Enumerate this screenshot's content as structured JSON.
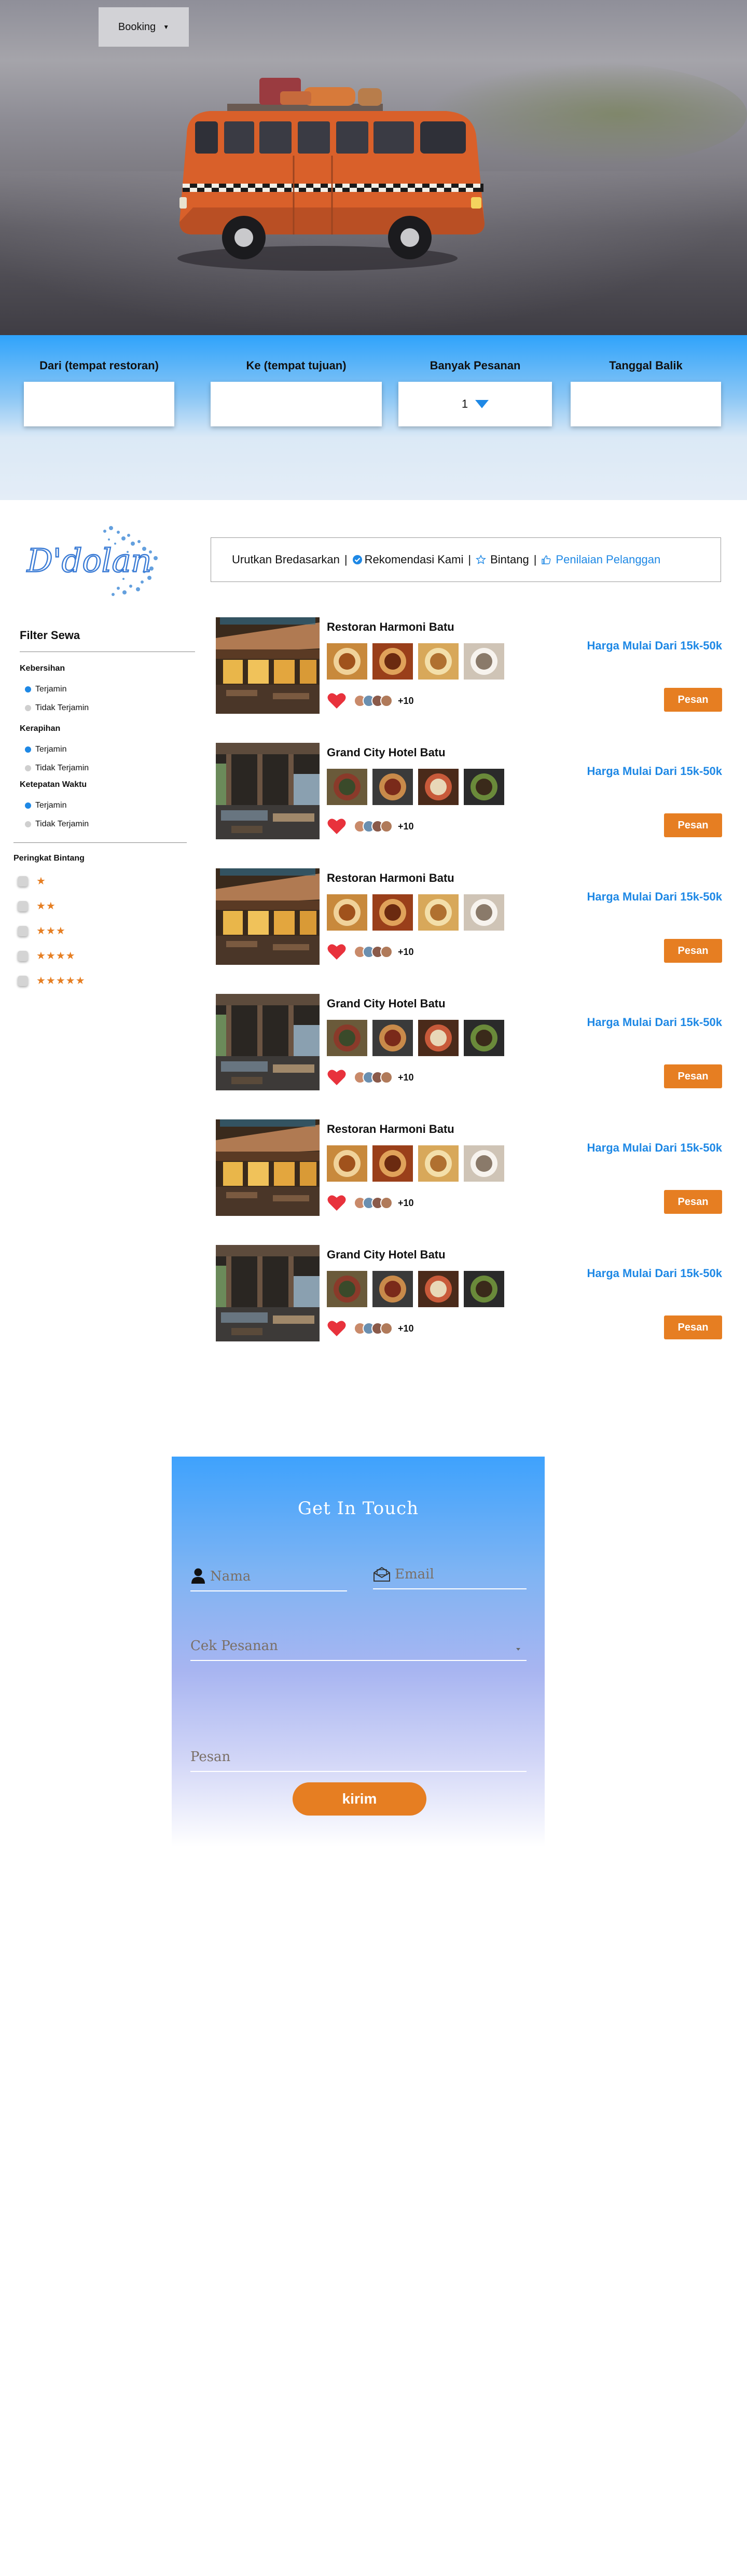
{
  "nav": {
    "booking_label": "Booking"
  },
  "search": {
    "from_label": "Dari (tempat restoran)",
    "to_label": "Ke (tempat tujuan)",
    "qty_label": "Banyak Pesanan",
    "qty_value": "1",
    "return_label": "Tanggal Balik"
  },
  "brand": {
    "logo_text": "D'dolan",
    "accent_color": "#1e88e5",
    "action_color": "#e67e22"
  },
  "sort": {
    "prefix": "Urutkan Bredasarkan",
    "options": [
      "Rekomendasi Kami",
      "Bintang",
      "Penilaian Pelanggan"
    ]
  },
  "filter": {
    "title": "Filter Sewa",
    "groups": [
      {
        "label": "Kebersihan",
        "options": [
          "Terjamin",
          "Tidak Terjamin"
        ]
      },
      {
        "label": "Kerapihan",
        "options": [
          "Terjamin",
          "Tidak Terjamin"
        ]
      },
      {
        "label": "Ketepatan Waktu",
        "options": [
          "Terjamin",
          "Tidak Terjamin"
        ]
      }
    ],
    "stars_title": "Peringkat Bintang",
    "star_rows": [
      "★",
      "★★",
      "★★★",
      "★★★★",
      "★★★★★"
    ]
  },
  "listings": [
    {
      "title": "Restoran Harmoni  Batu",
      "price": "Harga Mulai Dari 15k-50k",
      "more": "+10",
      "cta": "Pesan"
    },
    {
      "title": "Grand City Hotel Batu",
      "price": "Harga Mulai Dari 15k-50k",
      "more": "+10",
      "cta": "Pesan"
    },
    {
      "title": "Restoran Harmoni  Batu",
      "price": "Harga Mulai Dari 15k-50k",
      "more": "+10",
      "cta": "Pesan"
    },
    {
      "title": "Grand City Hotel Batu",
      "price": "Harga Mulai Dari 15k-50k",
      "more": "+10",
      "cta": "Pesan"
    },
    {
      "title": "Restoran Harmoni  Batu",
      "price": "Harga Mulai Dari 15k-50k",
      "more": "+10",
      "cta": "Pesan"
    },
    {
      "title": "Grand City Hotel Batu",
      "price": "Harga Mulai Dari 15k-50k",
      "more": "+10",
      "cta": "Pesan"
    }
  ],
  "contact": {
    "title": "Get In Touch",
    "name_placeholder": "Nama",
    "email_placeholder": "Email",
    "order_placeholder": "Cek Pesanan",
    "message_placeholder": "Pesan",
    "submit_label": "kirim"
  }
}
